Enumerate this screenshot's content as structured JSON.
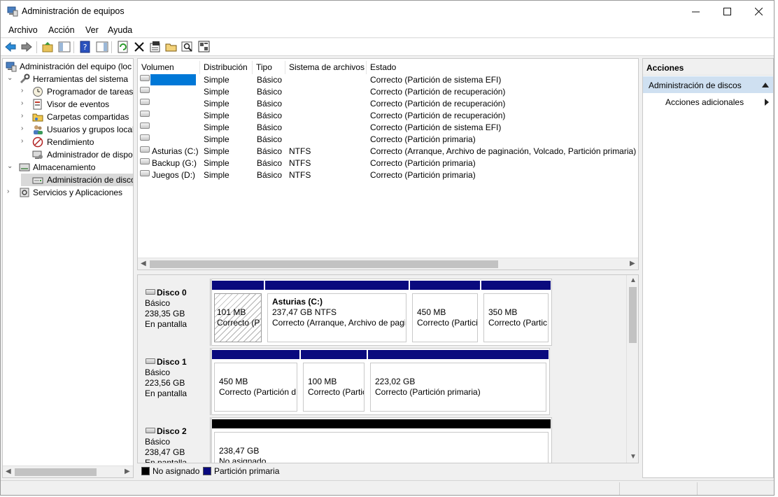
{
  "window": {
    "title": "Administración de equipos"
  },
  "menu": [
    "Archivo",
    "Acción",
    "Ver",
    "Ayuda"
  ],
  "toolbar": {
    "icons": [
      "back-arrow-icon",
      "forward-arrow-icon",
      "up-folder-icon",
      "show-hide-tree-icon",
      "help-icon",
      "show-hide-action-icon",
      "refresh-icon",
      "delete-icon",
      "properties-icon",
      "open-icon",
      "search-icon",
      "export-icon"
    ]
  },
  "tree": {
    "root": "Administración del equipo (loc",
    "system_tools": "Herramientas del sistema",
    "task_scheduler": "Programador de tareas",
    "event_viewer": "Visor de eventos",
    "shared_folders": "Carpetas compartidas",
    "local_users": "Usuarios y grupos locale",
    "performance": "Rendimiento",
    "device_manager": "Administrador de dispo",
    "storage": "Almacenamiento",
    "disk_management": "Administración de disco",
    "services_apps": "Servicios y Aplicaciones"
  },
  "volume_list": {
    "columns": [
      "Volumen",
      "Distribución",
      "Tipo",
      "Sistema de archivos",
      "Estado"
    ],
    "rows": [
      {
        "volume": "",
        "layout": "Simple",
        "type": "Básico",
        "fs": "",
        "status": "Correcto (Partición de sistema EFI)"
      },
      {
        "volume": "",
        "layout": "Simple",
        "type": "Básico",
        "fs": "",
        "status": "Correcto (Partición de recuperación)"
      },
      {
        "volume": "",
        "layout": "Simple",
        "type": "Básico",
        "fs": "",
        "status": "Correcto (Partición de recuperación)"
      },
      {
        "volume": "",
        "layout": "Simple",
        "type": "Básico",
        "fs": "",
        "status": "Correcto (Partición de recuperación)"
      },
      {
        "volume": "",
        "layout": "Simple",
        "type": "Básico",
        "fs": "",
        "status": "Correcto (Partición de sistema EFI)"
      },
      {
        "volume": "",
        "layout": "Simple",
        "type": "Básico",
        "fs": "",
        "status": "Correcto (Partición primaria)"
      },
      {
        "volume": "Asturias (C:)",
        "layout": "Simple",
        "type": "Básico",
        "fs": "NTFS",
        "status": "Correcto (Arranque, Archivo de paginación, Volcado, Partición primaria)"
      },
      {
        "volume": "Backup (G:)",
        "layout": "Simple",
        "type": "Básico",
        "fs": "NTFS",
        "status": "Correcto (Partición primaria)"
      },
      {
        "volume": "Juegos (D:)",
        "layout": "Simple",
        "type": "Básico",
        "fs": "NTFS",
        "status": "Correcto (Partición primaria)"
      }
    ]
  },
  "disks": [
    {
      "name": "Disco 0",
      "kind": "Básico",
      "size": "238,35 GB",
      "state": "En pantalla",
      "partitions": [
        {
          "title": "",
          "size": "101 MB",
          "status": "Correcto (P"
        },
        {
          "title": "Asturias  (C:)",
          "size": "237,47 GB NTFS",
          "status": "Correcto (Arranque, Archivo de pagi"
        },
        {
          "title": "",
          "size": "450 MB",
          "status": "Correcto (Partici"
        },
        {
          "title": "",
          "size": "350 MB",
          "status": "Correcto (Partic"
        }
      ]
    },
    {
      "name": "Disco 1",
      "kind": "Básico",
      "size": "223,56 GB",
      "state": "En pantalla",
      "partitions": [
        {
          "title": "",
          "size": "450 MB",
          "status": "Correcto (Partición d"
        },
        {
          "title": "",
          "size": "100 MB",
          "status": "Correcto (Partic"
        },
        {
          "title": "",
          "size": "223,02 GB",
          "status": "Correcto (Partición primaria)"
        }
      ]
    },
    {
      "name": "Disco 2",
      "kind": "Básico",
      "size": "238,47 GB",
      "state": "En pantalla",
      "partitions": [
        {
          "title": "",
          "size": "238,47 GB",
          "status": "No asignado"
        }
      ]
    }
  ],
  "legend": [
    {
      "label": "No asignado",
      "color": "#000000"
    },
    {
      "label": "Partición primaria",
      "color": "#0a0a7e"
    }
  ],
  "actions": {
    "header": "Acciones",
    "selected": "Administración de discos",
    "more": "Acciones adicionales"
  },
  "colors": {
    "primary_partition": "#0a0a7e",
    "unallocated": "#000000",
    "selection": "#0078d7",
    "action_selected": "#cfe0f1"
  }
}
